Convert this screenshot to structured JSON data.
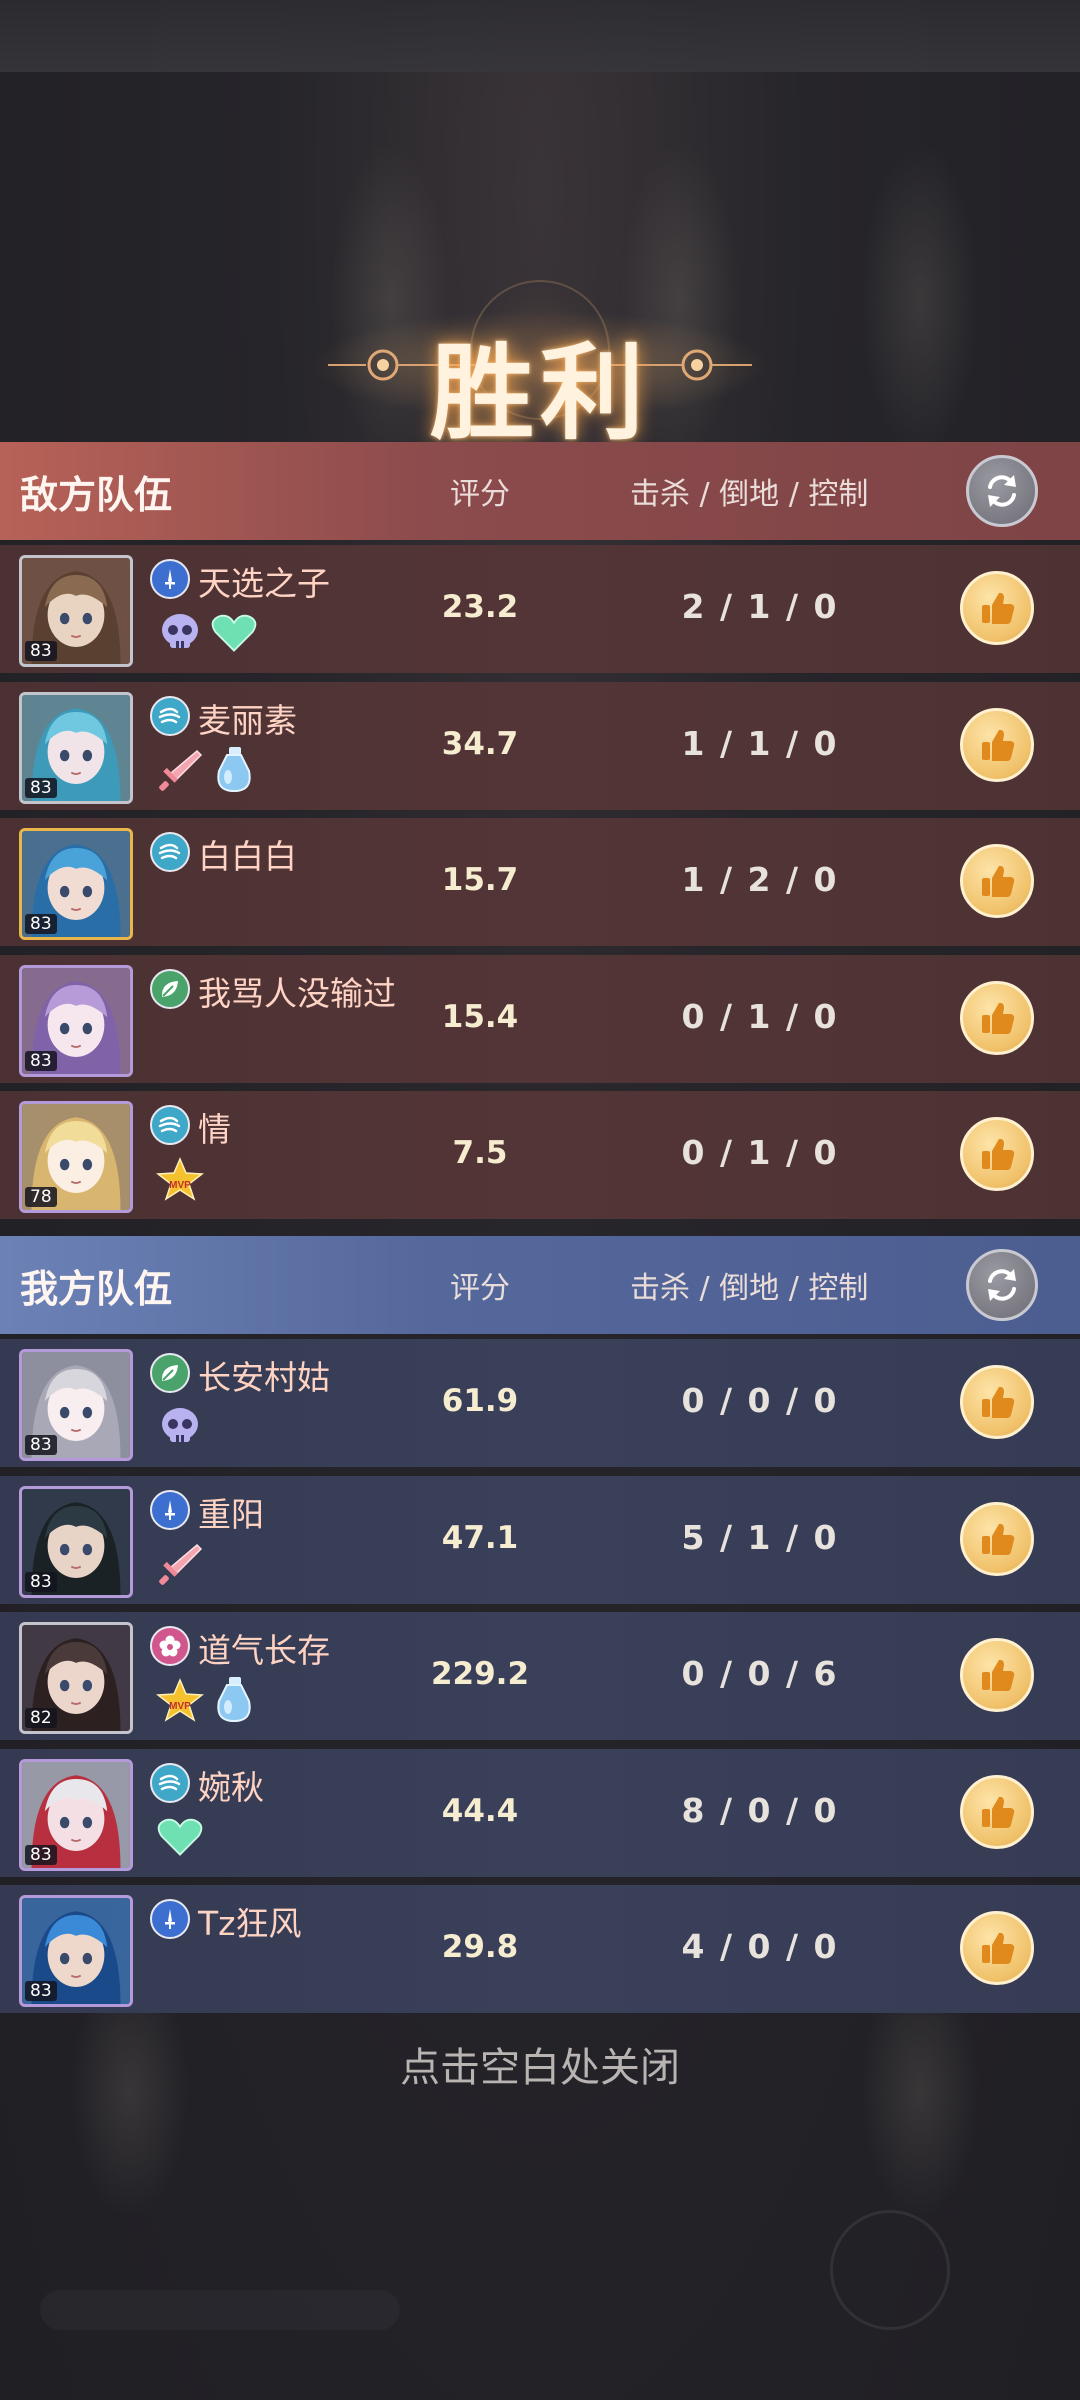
{
  "result_title": "胜利",
  "close_hint": "点击空白处关闭",
  "columns": {
    "score": "评分",
    "kdc": "击杀 / 倒地 / 控制"
  },
  "enemy_team": {
    "title": "敌方队伍",
    "players": [
      {
        "name": "天选之子",
        "level": "83",
        "role": "sword-icon",
        "score": "23.2",
        "kdc": "2 / 1 / 0",
        "badges": [
          "skull-badge-icon",
          "heart-badge-icon"
        ]
      },
      {
        "name": "麦丽素",
        "level": "83",
        "role": "wind-icon",
        "score": "34.7",
        "kdc": "1 / 1 / 0",
        "badges": [
          "sword-badge-icon",
          "potion-badge-icon"
        ]
      },
      {
        "name": "白白白",
        "level": "83",
        "role": "wind-icon",
        "score": "15.7",
        "kdc": "1 / 2 / 0",
        "badges": []
      },
      {
        "name": "我骂人没输过",
        "level": "83",
        "role": "leaf-icon",
        "score": "15.4",
        "kdc": "0 / 1 / 0",
        "badges": []
      },
      {
        "name": "情",
        "level": "78",
        "role": "wind-icon",
        "score": "7.5",
        "kdc": "0 / 1 / 0",
        "badges": [
          "mvp-star-badge-icon"
        ]
      }
    ]
  },
  "ally_team": {
    "title": "我方队伍",
    "players": [
      {
        "name": "长安村姑",
        "level": "83",
        "role": "leaf-icon",
        "score": "61.9",
        "kdc": "0 / 0 / 0",
        "badges": [
          "skull-badge-icon"
        ]
      },
      {
        "name": "重阳",
        "level": "83",
        "role": "sword-icon",
        "score": "47.1",
        "kdc": "5 / 1 / 0",
        "badges": [
          "sword-badge-icon"
        ]
      },
      {
        "name": "道气长存",
        "level": "82",
        "role": "flower-icon",
        "score": "229.2",
        "kdc": "0 / 0 / 6",
        "badges": [
          "mvp-star-badge-icon",
          "potion-badge-icon"
        ]
      },
      {
        "name": "婉秋",
        "level": "83",
        "role": "wind-icon",
        "score": "44.4",
        "kdc": "8 / 0 / 0",
        "badges": [
          "heart-badge-icon"
        ]
      },
      {
        "name": "Tz狂风",
        "level": "83",
        "role": "sword-icon",
        "score": "29.8",
        "kdc": "4 / 0 / 0",
        "badges": []
      }
    ]
  }
}
